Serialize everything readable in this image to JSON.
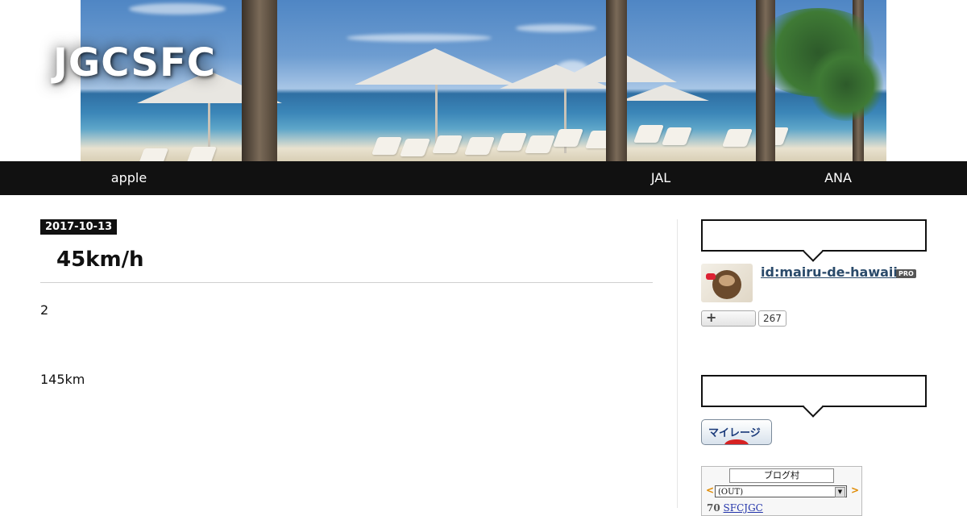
{
  "header": {
    "site_title": "JGCSFC"
  },
  "nav": {
    "items": [
      {
        "label": "apple"
      },
      {
        "label": "JAL"
      },
      {
        "label": "ANA"
      }
    ]
  },
  "article": {
    "date": "2017-10-13",
    "title": "45km/h",
    "paragraphs": [
      "2",
      "145km"
    ]
  },
  "sidebar": {
    "profile": {
      "id": "id:mairu-de-hawaii",
      "badge": "PRO",
      "follow_icon": "+",
      "follower_count": "267"
    },
    "mileage_button": {
      "label": "マイレージ"
    },
    "blogmura": {
      "title": "ブログ村",
      "prev": "<",
      "next": ">",
      "select_value": "(OUT)",
      "item_rank": "70",
      "item_label": "SFCJGC"
    }
  },
  "colors": {
    "nav_bg": "#111111",
    "link": "#2a4a6a",
    "accent_orange": "#e08a00",
    "mileage_red": "#d62222"
  },
  "icons": {
    "follow": "plus-icon",
    "dropdown": "chevron-down-icon"
  }
}
